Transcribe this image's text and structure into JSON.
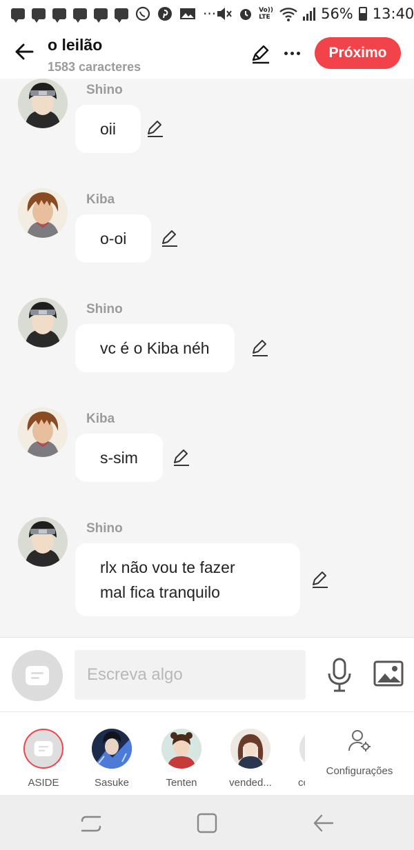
{
  "status_bar": {
    "battery": "56%",
    "time": "13:40",
    "dots": "···",
    "volte": "Vo)) LTE",
    "notification_icons": [
      "chat-bubble-icon",
      "chat-bubble-icon",
      "chat-bubble-icon",
      "chat-bubble-icon",
      "chat-bubble-icon",
      "chat-bubble-icon",
      "whatsapp-icon",
      "pinterest-icon",
      "image-icon"
    ]
  },
  "header": {
    "title": "o leilão",
    "subtitle": "1583 caracteres",
    "next_label": "Próximo",
    "accent_color": "#f2434a"
  },
  "messages": [
    {
      "sender": "Shino",
      "lines": [
        "oii"
      ]
    },
    {
      "sender": "Kiba",
      "lines": [
        "o-oi"
      ]
    },
    {
      "sender": "Shino",
      "lines": [
        "vc é o Kiba néh"
      ]
    },
    {
      "sender": "Kiba",
      "lines": [
        "s-sim"
      ]
    },
    {
      "sender": "Shino",
      "lines": [
        "rlx não vou te fazer",
        "mal fica tranquilo"
      ]
    }
  ],
  "compose": {
    "placeholder": "Escreva algo"
  },
  "characters": [
    {
      "label": "ASIDE",
      "selected": true
    },
    {
      "label": "Sasuke"
    },
    {
      "label": "Tenten"
    },
    {
      "label": "vended..."
    },
    {
      "label": "cc"
    }
  ],
  "settings_label": "Configurações"
}
